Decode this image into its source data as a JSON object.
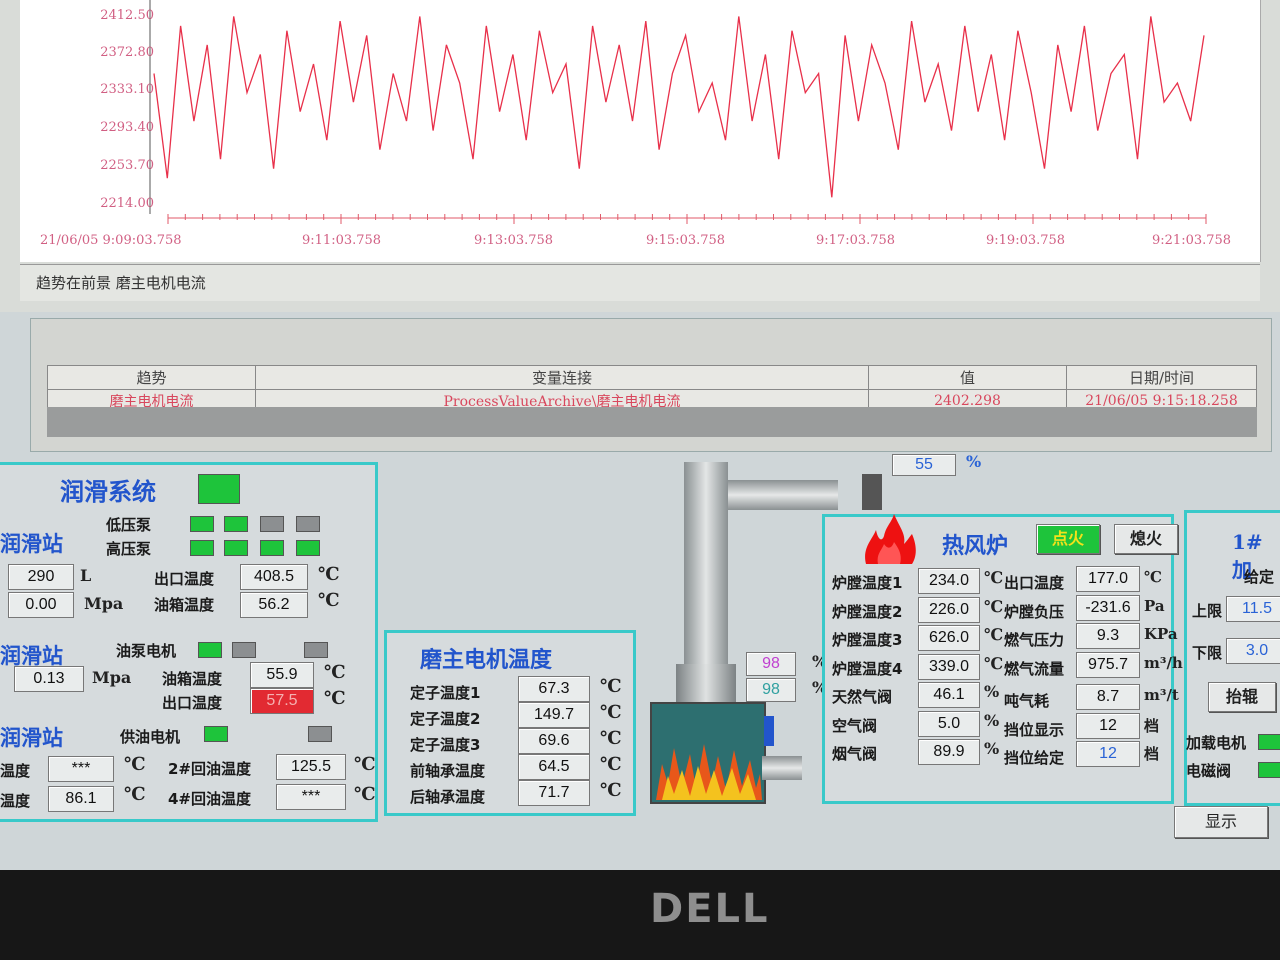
{
  "trend": {
    "y_ticks": [
      "2412.50",
      "2372.80",
      "2333.10",
      "2293.40",
      "2253.70",
      "2214.00"
    ],
    "x_ticks": [
      "21/06/05   9:09:03.758",
      "9:11:03.758",
      "9:13:03.758",
      "9:15:03.758",
      "9:17:03.758",
      "9:19:03.758",
      "9:21:03.758"
    ],
    "status": "趋势在前景 磨主电机电流",
    "line_color": "#e8304a"
  },
  "chart_data": {
    "type": "line",
    "title": "",
    "xlabel": "",
    "ylabel": "",
    "ylim": [
      2214.0,
      2412.5
    ],
    "x_range": [
      "21/06/05 9:09:03.758",
      "21/06/05 9:21:03.758"
    ],
    "series": [
      {
        "values": [
          2350,
          2240,
          2400,
          2300,
          2380,
          2260,
          2410,
          2330,
          2370,
          2250,
          2395,
          2310,
          2360,
          2280,
          2405,
          2320,
          2390,
          2270,
          2350,
          2300,
          2410,
          2290,
          2380,
          2340,
          2260,
          2400,
          2310,
          2370,
          2280,
          2395,
          2330,
          2360,
          2250,
          2400,
          2320,
          2380,
          2300,
          2405,
          2270,
          2350,
          2390,
          2310,
          2340,
          2280,
          2410,
          2300,
          2370,
          2260,
          2395,
          2330,
          2350,
          2220,
          2390,
          2300,
          2380,
          2340,
          2270,
          2405,
          2320,
          2360,
          2290,
          2400,
          2310,
          2370,
          2280,
          2395,
          2330,
          2250,
          2380,
          2310,
          2400,
          2290,
          2350,
          2370,
          2260,
          2410,
          2320,
          2340,
          2300,
          2390
        ]
      }
    ]
  },
  "ruler": {
    "headers": [
      "趋势",
      "变量连接",
      "值",
      "日期/时间"
    ],
    "row": [
      "磨主电机电流",
      "ProcessValueArchive\\磨主电机电流",
      "2402.298",
      "21/06/05 9:15:18.258"
    ]
  },
  "pipe_value": "55",
  "pipe_unit": "%",
  "lube": {
    "title": "润滑系统",
    "station1": "润滑站",
    "low_pump": "低压泵",
    "high_pump": "高压泵",
    "level": "290",
    "level_unit": "L",
    "pressure": "0.00",
    "pressure_unit": "Mpa",
    "out_temp_label": "出口温度",
    "out_temp": "408.5",
    "tank_temp_label": "油箱温度",
    "tank_temp": "56.2",
    "station2": "润滑站",
    "pump_motor": "油泵电机",
    "pressure2": "0.13",
    "pressure2_unit": "Mpa",
    "tank_temp2_label": "油箱温度",
    "tank_temp2": "55.9",
    "out_temp2_label": "出口温度",
    "out_temp2": "57.5",
    "station3": "润滑站",
    "supply_motor": "供油电机",
    "temp_a_label": "温度",
    "temp_a": "***",
    "return2_label": "2#回油温度",
    "return2": "125.5",
    "temp_b_label": "温度",
    "temp_b": "86.1",
    "return4_label": "4#回油温度",
    "return4": "***",
    "unit_c": "℃"
  },
  "motor": {
    "title": "磨主电机温度",
    "rows": [
      {
        "label": "定子温度1",
        "value": "67.3"
      },
      {
        "label": "定子温度2",
        "value": "149.7"
      },
      {
        "label": "定子温度3",
        "value": "69.6"
      },
      {
        "label": "前轴承温度",
        "value": "64.5"
      },
      {
        "label": "后轴承温度",
        "value": "71.7"
      }
    ],
    "unit": "℃"
  },
  "valves": {
    "v1": "98",
    "v2": "98",
    "unit": "%"
  },
  "furnace": {
    "title": "热风炉",
    "ignite": "点火",
    "extinguish": "熄火",
    "left": [
      {
        "label": "炉膛温度1",
        "value": "234.0",
        "unit": "℃"
      },
      {
        "label": "炉膛温度2",
        "value": "226.0",
        "unit": "℃"
      },
      {
        "label": "炉膛温度3",
        "value": "626.0",
        "unit": "℃"
      },
      {
        "label": "炉膛温度4",
        "value": "339.0",
        "unit": "℃"
      },
      {
        "label": "天然气阀",
        "value": "46.1",
        "unit": "%"
      },
      {
        "label": "空气阀",
        "value": "5.0",
        "unit": "%"
      },
      {
        "label": "烟气阀",
        "value": "89.9",
        "unit": "%"
      }
    ],
    "right": [
      {
        "label": "出口温度",
        "value": "177.0",
        "unit": "℃"
      },
      {
        "label": "炉膛负压",
        "value": "-231.6",
        "unit": "Pa"
      },
      {
        "label": "燃气压力",
        "value": "9.3",
        "unit": "KPa"
      },
      {
        "label": "燃气流量",
        "value": "975.7",
        "unit": "m³/h"
      },
      {
        "label": "吨气耗",
        "value": "8.7",
        "unit": "m³/t"
      },
      {
        "label": "挡位显示",
        "value": "12",
        "unit": "档"
      },
      {
        "label": "挡位给定",
        "value": "12",
        "unit": "档"
      }
    ]
  },
  "feeder": {
    "title": "1#加",
    "setpoint_label": "给定",
    "upper_label": "上限",
    "upper": "11.5",
    "lower_label": "下限",
    "lower": "3.0",
    "lift_button": "抬辊",
    "motor_label": "加载电机",
    "valve_label": "电磁阀"
  },
  "display_button": "显示",
  "brand": "DELL"
}
